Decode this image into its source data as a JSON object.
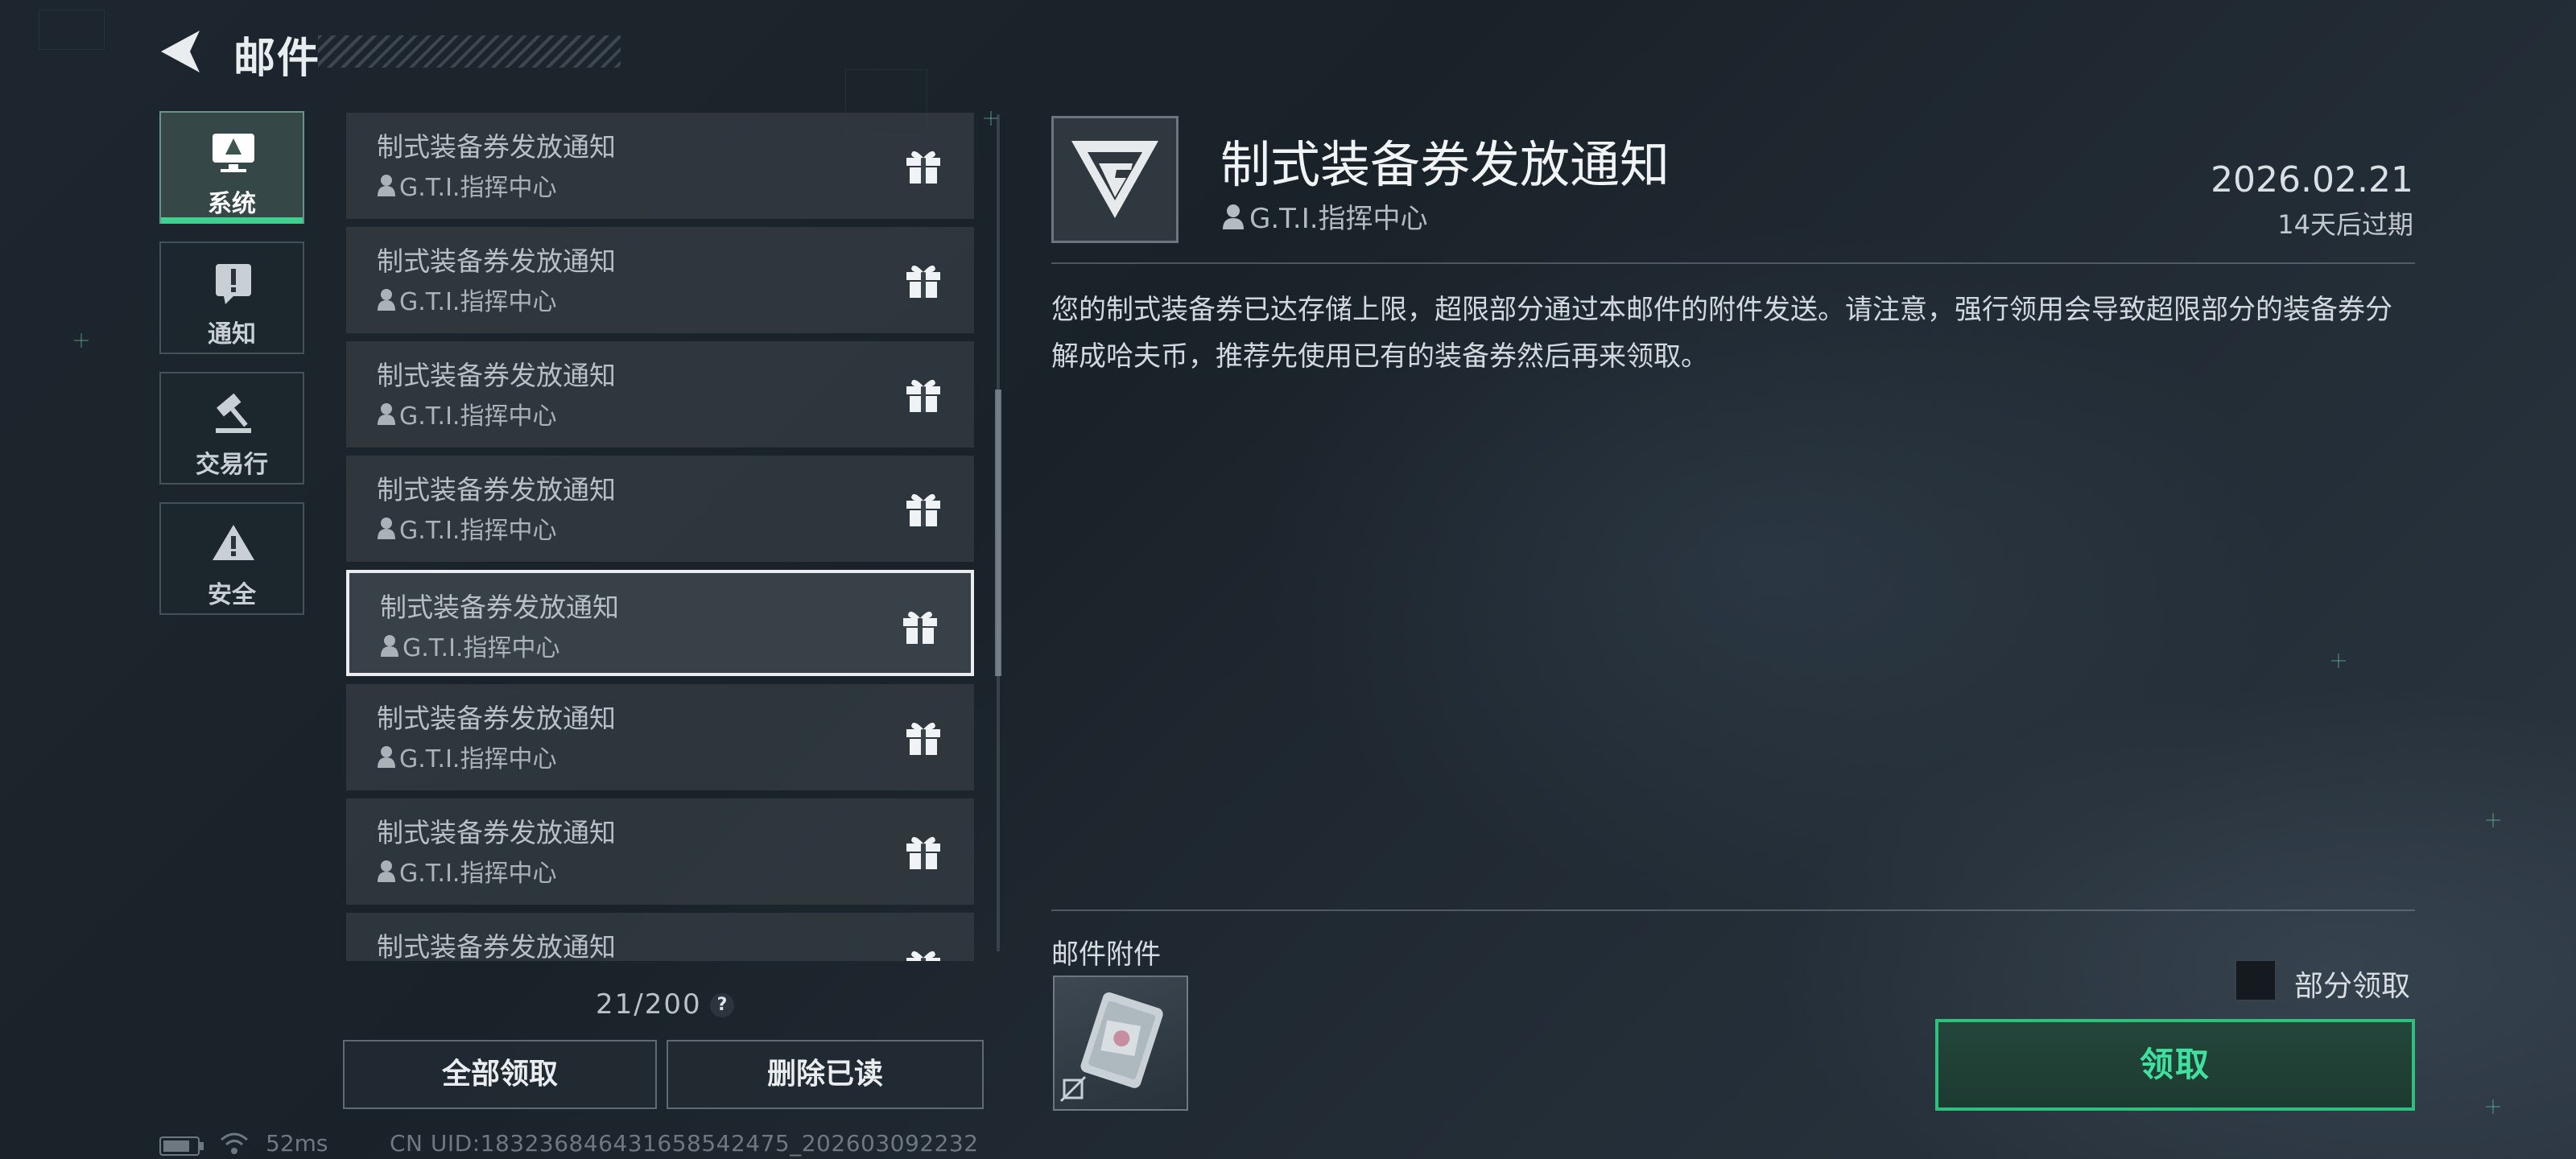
{
  "header": {
    "title": "邮件"
  },
  "categories": [
    {
      "label": "系统",
      "icon": "monitor-icon",
      "active": true
    },
    {
      "label": "通知",
      "icon": "exclamation-icon",
      "active": false
    },
    {
      "label": "交易行",
      "icon": "gavel-icon",
      "active": false
    },
    {
      "label": "安全",
      "icon": "warning-icon",
      "active": false
    }
  ],
  "mail_list": {
    "items": [
      {
        "title": "制式装备券发放通知",
        "sender": "G.T.I.指挥中心"
      },
      {
        "title": "制式装备券发放通知",
        "sender": "G.T.I.指挥中心"
      },
      {
        "title": "制式装备券发放通知",
        "sender": "G.T.I.指挥中心"
      },
      {
        "title": "制式装备券发放通知",
        "sender": "G.T.I.指挥中心"
      },
      {
        "title": "制式装备券发放通知",
        "sender": "G.T.I.指挥中心",
        "selected": true
      },
      {
        "title": "制式装备券发放通知",
        "sender": "G.T.I.指挥中心"
      },
      {
        "title": "制式装备券发放通知",
        "sender": "G.T.I.指挥中心"
      },
      {
        "title": "制式装备券发放通知",
        "sender": ""
      }
    ],
    "count": "21/200",
    "help": "?",
    "claim_all_label": "全部领取",
    "delete_read_label": "删除已读"
  },
  "status": {
    "ping": "52ms",
    "uid": "CN UID:18323684643165854247­5_202603092232"
  },
  "detail": {
    "title": "制式装备券发放通知",
    "sender": "G.T.I.指挥中心",
    "date": "2026.02.21",
    "expire": "14天后过期",
    "body": "您的制式装备券已达存储上限，超限部分通过本邮件的附件发送。请注意，强行领用会导致超限部分的装备券分解成哈夫币，推荐先使用已有的装备券然后再来领取。",
    "attachments_label": "邮件附件",
    "partial_claim_label": "部分领取",
    "claim_label": "领取"
  },
  "colors": {
    "accent": "#3fcf8e",
    "claim_text": "#3fe0a0"
  }
}
